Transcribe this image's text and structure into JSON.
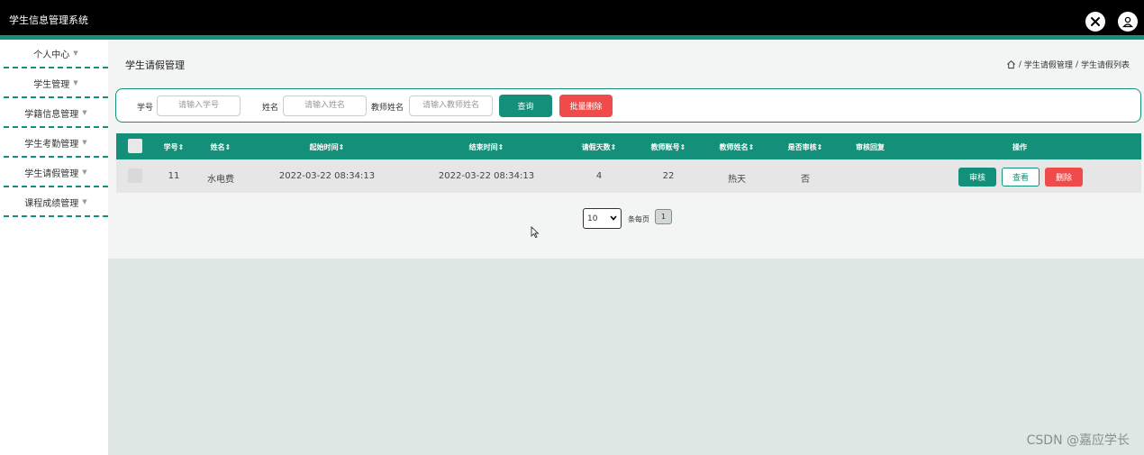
{
  "app": {
    "title": "学生信息管理系统"
  },
  "sidebar": {
    "items": [
      {
        "label": "个人中心"
      },
      {
        "label": "学生管理"
      },
      {
        "label": "学籍信息管理"
      },
      {
        "label": "学生考勤管理"
      },
      {
        "label": "学生请假管理"
      },
      {
        "label": "课程成绩管理"
      }
    ]
  },
  "page": {
    "title": "学生请假管理"
  },
  "breadcrumb": {
    "sep": "/",
    "items": [
      "学生请假管理",
      "学生请假列表"
    ]
  },
  "search": {
    "student_id_label": "学号",
    "student_id_placeholder": "请输入学号",
    "name_label": "姓名",
    "name_placeholder": "请输入姓名",
    "teacher_label": "教师姓名",
    "teacher_placeholder": "请输入教师姓名",
    "query_button": "查询",
    "batch_delete_button": "批量删除"
  },
  "table": {
    "headers": [
      "学号",
      "姓名",
      "起始时间",
      "结束时间",
      "请假天数",
      "教师账号",
      "教师姓名",
      "是否审核",
      "审核回复",
      "操作"
    ],
    "sort_glyph": "⇕",
    "rows": [
      {
        "student_id": "11",
        "name": "水电费",
        "start": "2022-03-22 08:34:13",
        "end": "2022-03-22 08:34:13",
        "days": "4",
        "teacher_account": "22",
        "teacher_name": "热天",
        "reviewed": "否",
        "reply": "",
        "actions": {
          "review": "审核",
          "view": "查看",
          "delete": "删除"
        }
      }
    ]
  },
  "pagination": {
    "page_size": "10",
    "per_page_label": "条每页",
    "current_page": "1"
  },
  "watermark": "CSDN @嘉应学长",
  "colors": {
    "primary": "#14907a",
    "danger": "#f04b4b",
    "topbar": "#000000"
  }
}
